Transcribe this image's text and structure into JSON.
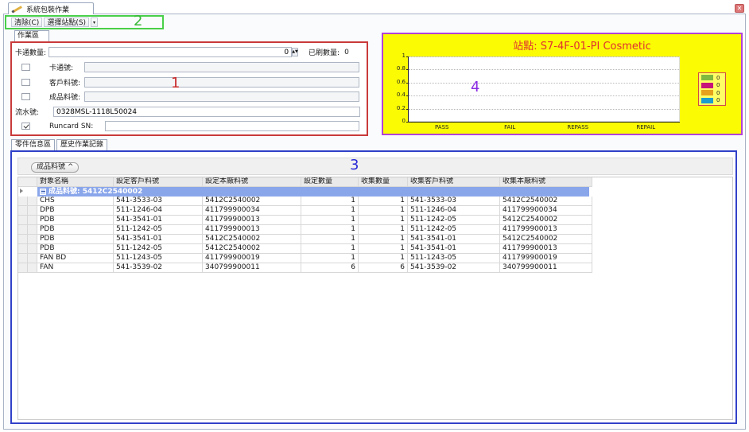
{
  "window": {
    "tab_title": "系統包裝作業",
    "close_glyph": "✕"
  },
  "toolbar": {
    "clear_label": "清除(C)",
    "select_station_label": "選擇站點(S)",
    "dropdown_glyph": "▾"
  },
  "annotations": {
    "n1": "1",
    "n2": "2",
    "n3": "3",
    "n4": "4"
  },
  "work_area": {
    "tab_label": "作業區",
    "card_count_label": "卡通數量:",
    "card_count_value": "0",
    "scanned_count_label": "已刷數量:",
    "scanned_count_value": "0",
    "card_no_label": "卡通號:",
    "customer_part_label": "客戶料號:",
    "product_part_label": "成品料號:",
    "serial_label": "流水號:",
    "serial_value": "0328MSL-1118L50024",
    "runcard_label": "Runcard SN:"
  },
  "chart_data": {
    "type": "bar",
    "title": "站點: S7-4F-01-PI Cosmetic",
    "categories": [
      "PASS",
      "FAIL",
      "REPASS",
      "REPAIL"
    ],
    "series": [
      {
        "values": [
          0,
          0,
          0,
          0
        ],
        "color": "#7fb93f"
      },
      {
        "values": [
          0,
          0,
          0,
          0
        ],
        "color": "#c7157a"
      },
      {
        "values": [
          0,
          0,
          0,
          0
        ],
        "color": "#e6a21a"
      },
      {
        "values": [
          0,
          0,
          0,
          0
        ],
        "color": "#1c9ccf"
      }
    ],
    "y_ticks": [
      "0",
      "0.2",
      "0.4",
      "0.6",
      "0.8",
      "1"
    ],
    "ylim": [
      0,
      1
    ],
    "legend_values": [
      "0",
      "0",
      "0",
      "0"
    ],
    "legend_position": "right",
    "grid": true
  },
  "bottom_tabs": [
    "零件信息區",
    "歷史作業記錄"
  ],
  "grid": {
    "group_chip_label": "成品料號 ^",
    "columns": [
      "對象名稱",
      "設定客戶料號",
      "設定本廠料號",
      "設定數量",
      "收集數量",
      "收集客戶料號",
      "收集本廠料號"
    ],
    "group_label": "成品料號: 5412C2540002",
    "rows": [
      [
        "CHS",
        "541-3533-03",
        "5412C2540002",
        "1",
        "1",
        "541-3533-03",
        "5412C2540002"
      ],
      [
        "DPB",
        "511-1246-04",
        "411799900034",
        "1",
        "1",
        "511-1246-04",
        "411799900034"
      ],
      [
        "PDB",
        "541-3541-01",
        "411799900013",
        "1",
        "1",
        "511-1242-05",
        "5412C2540002"
      ],
      [
        "PDB",
        "511-1242-05",
        "411799900013",
        "1",
        "1",
        "511-1242-05",
        "411799900013"
      ],
      [
        "PDB",
        "541-3541-01",
        "5412C2540002",
        "1",
        "1",
        "541-3541-01",
        "5412C2540002"
      ],
      [
        "PDB",
        "511-1242-05",
        "5412C2540002",
        "1",
        "1",
        "541-3541-01",
        "411799900013"
      ],
      [
        "FAN BD",
        "511-1243-05",
        "411799900019",
        "1",
        "1",
        "511-1243-05",
        "411799900019"
      ],
      [
        "FAN",
        "541-3539-02",
        "340799900011",
        "6",
        "6",
        "541-3539-02",
        "340799900011"
      ]
    ]
  }
}
